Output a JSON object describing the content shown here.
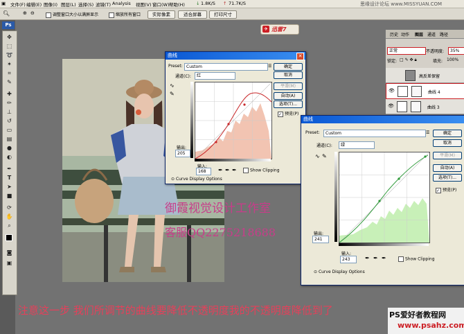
{
  "menu": {
    "items": [
      "文件(F)",
      "编辑(E)",
      "图像(I)",
      "图层(L)",
      "选择(S)",
      "滤镜(T)",
      "Analysis",
      "视图(V)",
      "窗口(W)",
      "帮助(H)"
    ],
    "speed_down": "1.8K/S",
    "speed_up": "71.7K/S",
    "site_watermark": "思缘设计论坛 www.MISSYUAN.COM"
  },
  "options_bar": {
    "resize_windows": "调整窗口大小以满屏显示",
    "zoom_all": "缩放所有窗口",
    "actual_pixels": "实际像素",
    "fit_screen": "适合屏幕",
    "print_size": "打印尺寸"
  },
  "ps_logo": "Ps",
  "xunlei_badge": "迅雷7",
  "curves1": {
    "title": "曲线",
    "preset_label": "Preset:",
    "preset_value": "Custom",
    "channel_label": "通道(C):",
    "channel_value": "红",
    "ok": "确定",
    "cancel": "取消",
    "smooth": "平滑(M)",
    "auto": "自动(A)",
    "options": "选项(T)...",
    "preview": "预览(P)",
    "output_label": "输出:",
    "output_value": "205",
    "input_label": "输入:",
    "input_value": "168",
    "show_clipping": "Show Clipping",
    "display_options": "Curve Display Options"
  },
  "curves2": {
    "title": "曲线",
    "preset_label": "Preset:",
    "preset_value": "Custom",
    "channel_label": "通道(C):",
    "channel_value": "绿",
    "ok": "确定",
    "cancel": "取消",
    "smooth": "平滑(M)",
    "auto": "自动(A)",
    "options": "选项(T)...",
    "preview": "预览(P)",
    "output_label": "输出:",
    "output_value": "241",
    "input_label": "输入:",
    "input_value": "243",
    "show_clipping": "Show Clipping",
    "display_options": "Curve Display Options"
  },
  "layers_panel": {
    "tabs": [
      "历史",
      "动作",
      "图层",
      "通道",
      "路径"
    ],
    "blend_mode": "正常",
    "opacity_label": "不透明度:",
    "opacity_value": "35%",
    "lock_label": "锁定:",
    "fill_label": "填充:",
    "fill_value": "100%",
    "layers": [
      {
        "name": "高反差保留"
      },
      {
        "name": "曲线 4"
      },
      {
        "name": "曲线 3"
      }
    ]
  },
  "watermarks": {
    "studio": "御霞视觉设计工作室",
    "qq": "客服QQ2275218688",
    "bottom_note": "注意这一步 我们所调节的曲线要降低不透明度我的不透明度降低到了",
    "logo_text": "PS爱好者教程网",
    "logo_url": "www.psahz.com"
  },
  "colors": {
    "accent_red": "#cc1e24",
    "titlebar_blue": "#0a58d4",
    "watermark_pink": "#c83c8a"
  }
}
